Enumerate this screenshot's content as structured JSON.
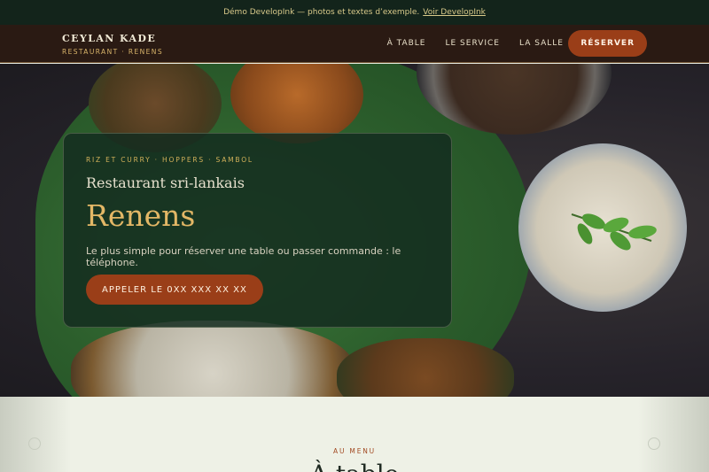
{
  "notice": {
    "text": "Démo DevelopInk — photos et textes d’exemple.",
    "link_label": "Voir DevelopInk"
  },
  "nav": {
    "brand_name": "CEYLAN KADE",
    "brand_sub": "RESTAURANT · RENENS",
    "links": [
      "À TABLE",
      "LE SERVICE",
      "LA SALLE"
    ],
    "cta_label": "RÉSERVER"
  },
  "hero": {
    "tagline": "RIZ ET CURRY · HOPPERS · SAMBOL",
    "subtitle": "Restaurant sri-lankais",
    "title": "Renens",
    "text": "Le plus simple pour réserver une table ou passer commande : le téléphone.",
    "button_label": "APPELER LE 0XX XXX XX XX"
  },
  "menu_section": {
    "eyebrow": "AU MENU",
    "title": "À table"
  },
  "colors": {
    "accent": "#9a3e18",
    "gold": "#d2b15a",
    "dark_green": "#13241b"
  }
}
